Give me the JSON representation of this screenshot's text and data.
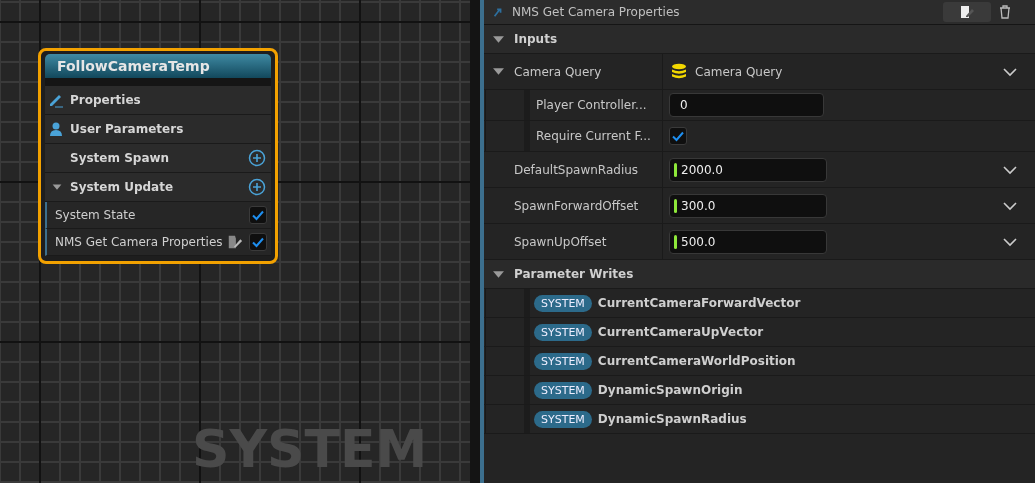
{
  "graph": {
    "node": {
      "title": "FollowCameraTemp",
      "sections": [
        {
          "label": "Properties",
          "kind": "properties"
        },
        {
          "label": "User Parameters",
          "kind": "user"
        },
        {
          "label": "System Spawn",
          "kind": "stage",
          "expanded": false
        },
        {
          "label": "System Update",
          "kind": "stage",
          "expanded": true
        }
      ],
      "modules": [
        {
          "label": "System State",
          "enabled": true,
          "edited": false
        },
        {
          "label": "NMS Get Camera Properties",
          "enabled": true,
          "edited": true
        }
      ]
    },
    "background_label": "SYSTEM"
  },
  "details": {
    "title": "NMS Get Camera Properties",
    "inputs": {
      "label": "Inputs",
      "expanded": true,
      "rows": [
        {
          "kind": "struct",
          "label": "Camera Query",
          "value": "Camera Query",
          "expanded": true,
          "children": [
            {
              "kind": "int",
              "label": "Player Controller...",
              "value": "0"
            },
            {
              "kind": "bool",
              "label": "Require Current F...",
              "checked": true
            }
          ]
        },
        {
          "kind": "float",
          "label": "DefaultSpawnRadius",
          "value": "2000.0"
        },
        {
          "kind": "float",
          "label": "SpawnForwardOffset",
          "value": "300.0"
        },
        {
          "kind": "float",
          "label": "SpawnUpOffset",
          "value": "500.0"
        }
      ]
    },
    "writes": {
      "label": "Parameter Writes",
      "expanded": true,
      "items": [
        {
          "namespace": "SYSTEM",
          "name": "CurrentCameraForwardVector"
        },
        {
          "namespace": "SYSTEM",
          "name": "CurrentCameraUpVector"
        },
        {
          "namespace": "SYSTEM",
          "name": "CurrentCameraWorldPosition"
        },
        {
          "namespace": "SYSTEM",
          "name": "DynamicSpawnOrigin"
        },
        {
          "namespace": "SYSTEM",
          "name": "DynamicSpawnRadius"
        }
      ]
    }
  }
}
